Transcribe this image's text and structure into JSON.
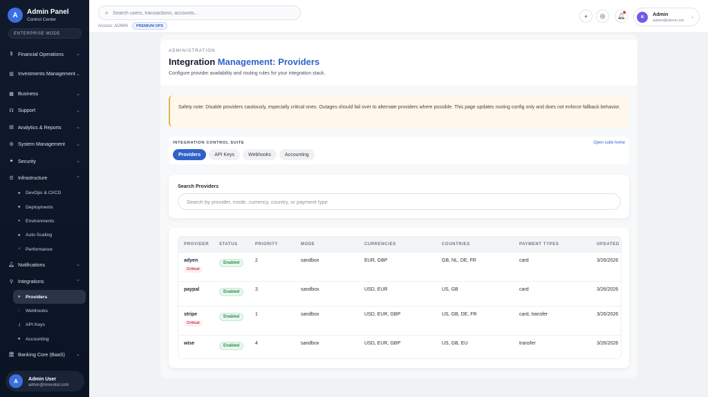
{
  "brand": {
    "title": "Admin Panel",
    "subtitle": "Control Center",
    "logo_letter": "A",
    "mode": "ENTERPRISE MODE"
  },
  "sidebar": {
    "items": [
      {
        "label": "Financial Operations",
        "icon": "dollar-icon"
      },
      {
        "label": "Investments Management",
        "icon": "chart-icon"
      },
      {
        "label": "Business",
        "icon": "briefcase-icon"
      },
      {
        "label": "Support",
        "icon": "headset-icon"
      },
      {
        "label": "Analytics & Reports",
        "icon": "analytics-icon"
      },
      {
        "label": "System Management",
        "icon": "gear-icon"
      },
      {
        "label": "Security",
        "icon": "lock-icon"
      },
      {
        "label": "Infrastructure",
        "icon": "server-icon"
      },
      {
        "label": "Notifications",
        "icon": "bell-icon"
      },
      {
        "label": "Integrations",
        "icon": "plug-icon"
      },
      {
        "label": "Banking Core (BaaS)",
        "icon": "bank-icon"
      }
    ],
    "infrastructure_sub": [
      "DevOps & CI/CD",
      "Deployments",
      "Environments",
      "Auto Scaling",
      "Performance"
    ],
    "integrations_sub": [
      "Providers",
      "Webhooks",
      "API Keys",
      "Accounting"
    ]
  },
  "user": {
    "initial": "A",
    "name": "Admin User",
    "email": "admin@mrevolut.com"
  },
  "topbar": {
    "search_placeholder": "Search users, transactions, accounts...",
    "access": "Access: ADMIN",
    "premium": "PREMIUM OPS",
    "profile": {
      "initial": "a",
      "name": "Admin",
      "email": "admin@demo.sm"
    }
  },
  "header": {
    "eyebrow": "ADMINISTRATION",
    "title_part1": "Integration",
    "title_part2": "Management: Providers",
    "description": "Configure provider availability and routing rules for your integration stack."
  },
  "note": "Safety note: Disable providers cautiously, especially critical ones. Outages should fail over to alternate providers where possible. This page updates routing config only and does not enforce fallback behavior.",
  "suite": {
    "title": "INTEGRATION CONTROL SUITE",
    "link": "Open suite home",
    "tabs": [
      "Providers",
      "API Keys",
      "Webhooks",
      "Accounting"
    ]
  },
  "search_card": {
    "label": "Search Providers",
    "placeholder": "Search by provider, mode, currency, country, or payment type"
  },
  "table": {
    "columns": [
      "PROVIDER",
      "STATUS",
      "PRIORITY",
      "MODE",
      "CURRENCIES",
      "COUNTRIES",
      "PAYMENT TYPES",
      "UPDATED"
    ],
    "rows": [
      {
        "provider": "adyen",
        "critical": "Critical",
        "status": "Enabled",
        "priority": "2",
        "mode": "sandbox",
        "currencies": "EUR, GBP",
        "countries": "GB, NL, DE, FR",
        "payment_types": "card",
        "updated": "3/26/2026"
      },
      {
        "provider": "paypal",
        "critical": "",
        "status": "Enabled",
        "priority": "3",
        "mode": "sandbox",
        "currencies": "USD, EUR",
        "countries": "US, GB",
        "payment_types": "card",
        "updated": "3/26/2026"
      },
      {
        "provider": "stripe",
        "critical": "Critical",
        "status": "Enabled",
        "priority": "1",
        "mode": "sandbox",
        "currencies": "USD, EUR, GBP",
        "countries": "US, GB, DE, FR",
        "payment_types": "card, transfer",
        "updated": "3/26/2026"
      },
      {
        "provider": "wise",
        "critical": "",
        "status": "Enabled",
        "priority": "4",
        "mode": "sandbox",
        "currencies": "USD, EUR, GBP",
        "countries": "US, GB, EU",
        "payment_types": "transfer",
        "updated": "3/26/2026"
      }
    ]
  }
}
